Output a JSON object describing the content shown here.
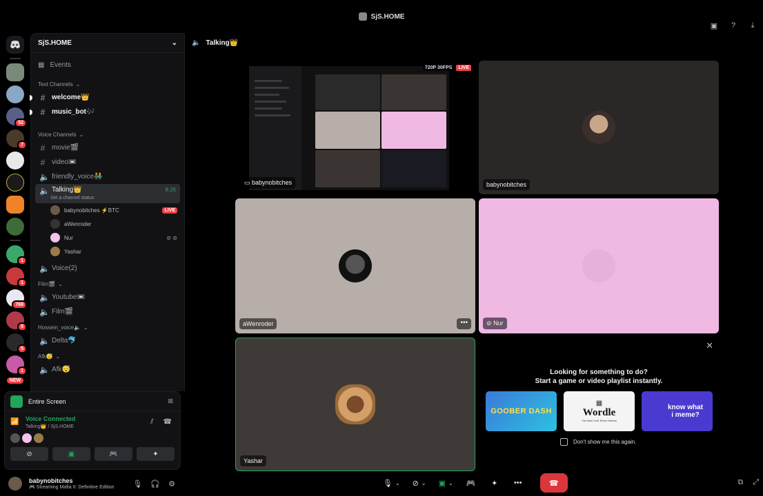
{
  "titlebar": {
    "server_title": "SjS.HOME"
  },
  "rail": {
    "badges": [
      "52",
      "7",
      "1",
      "1",
      "769",
      "5",
      "5",
      "1"
    ],
    "new_label": "NEW"
  },
  "sidebar": {
    "server_name": "SjS.HOME",
    "events_label": "Events",
    "text_category": "Text Channels",
    "text_channels": [
      "welcome👑",
      "music_bot🎶"
    ],
    "voice_category": "Voice Channels",
    "voice_channels_top": [
      "movie🎬",
      "video📼",
      "friendly_voice👬"
    ],
    "active_channel": {
      "name": "Talking👑",
      "timer": "8:26",
      "status": "Set a channel status"
    },
    "voice_users": [
      {
        "name": "babynobitches ⚡BTC",
        "live": "LIVE"
      },
      {
        "name": "aWenroder"
      },
      {
        "name": "Nur"
      },
      {
        "name": "Yashar"
      }
    ],
    "voice2": "Voice(2)",
    "film_category": "Film🎬",
    "film_channels": [
      "Youtube📼",
      "Film🎬"
    ],
    "hossein_category": "Hossein_voice🔈",
    "hossein_channels": [
      "Delta🐬"
    ],
    "afk_category": "Afk😴",
    "afk_channels": [
      "Afk😴"
    ]
  },
  "voice_panel": {
    "share_label": "Entire Screen",
    "connected": "Voice Connected",
    "location": "Talking👑 / SjS.HOME"
  },
  "user": {
    "name": "babynobitches",
    "status": "🎮 Streaming Mafia II: Definitive Edition"
  },
  "main": {
    "channel_title": "Talking👑",
    "stream": {
      "quality": "720P 30FPS",
      "live": "LIVE",
      "name": "babynobitches"
    },
    "tiles": [
      {
        "name": "babynobitches"
      },
      {
        "name": "aWenroder"
      },
      {
        "name": "Nur"
      },
      {
        "name": "Yashar"
      }
    ]
  },
  "activity": {
    "title_line1": "Looking for something to do?",
    "title_line2": "Start a game or video playlist instantly.",
    "cards": [
      "GOOBER DASH",
      "Wordle",
      "know what i meme?"
    ],
    "wordle_sub": "The New York Times Games",
    "dont_show": "Don't show me this again."
  },
  "colors": {
    "accent_green": "#23a55a",
    "danger": "#da373c",
    "tile_grey": "#b7aea9",
    "tile_pink": "#efb9e4"
  }
}
